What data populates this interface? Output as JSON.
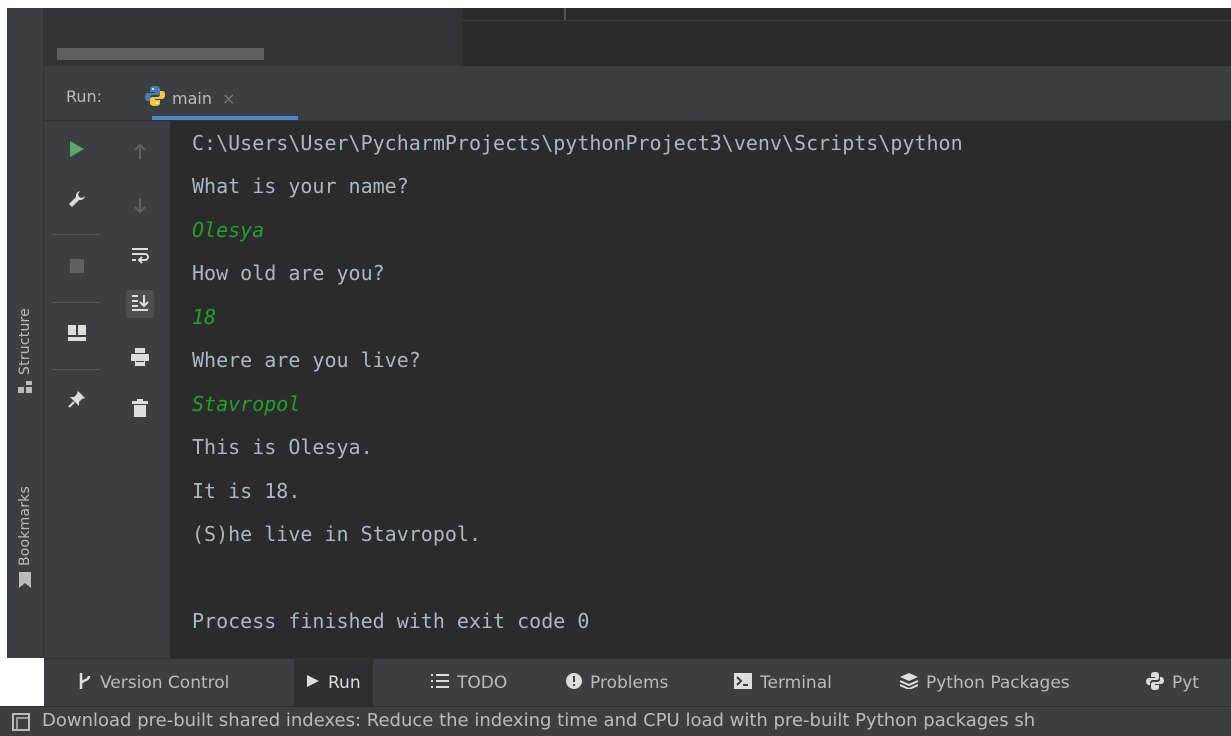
{
  "run_window": {
    "label": "Run:",
    "tab_label": "main",
    "tab_close": "×"
  },
  "left_strip": {
    "structure_label": "Structure",
    "bookmarks_label": "Bookmarks"
  },
  "toolbar_primary": [
    {
      "icon": "run-icon",
      "color": "#59a869"
    },
    {
      "icon": "wrench-icon"
    },
    {
      "icon": "stop-icon",
      "disabled": true
    },
    {
      "icon": "layout-icon"
    },
    {
      "icon": "pin-icon"
    }
  ],
  "toolbar_secondary": [
    {
      "icon": "arrow-up-icon",
      "disabled": true
    },
    {
      "icon": "arrow-down-icon",
      "disabled": true
    },
    {
      "icon": "soft-wrap-icon"
    },
    {
      "icon": "scroll-to-end-icon",
      "active": true
    },
    {
      "icon": "print-icon"
    },
    {
      "icon": "trash-icon"
    }
  ],
  "console": {
    "lines": [
      {
        "text": "C:\\Users\\User\\PycharmProjects\\pythonProject3\\venv\\Scripts\\python",
        "type": "output"
      },
      {
        "text": "What is your name?",
        "type": "output"
      },
      {
        "text": "Olesya",
        "type": "input"
      },
      {
        "text": "How old are you?",
        "type": "output"
      },
      {
        "text": "18",
        "type": "input"
      },
      {
        "text": "Where are you live?",
        "type": "output"
      },
      {
        "text": "Stavropol",
        "type": "input"
      },
      {
        "text": "This is Olesya.",
        "type": "output"
      },
      {
        "text": "It is 18.",
        "type": "output"
      },
      {
        "text": "(S)he live in Stavropol.",
        "type": "output"
      },
      {
        "text": "",
        "type": "output"
      },
      {
        "text": "Process finished with exit code 0",
        "type": "output"
      }
    ]
  },
  "bottom_tabs": [
    {
      "label": "Version Control",
      "icon": "branch-icon"
    },
    {
      "label": "Run",
      "icon": "play-icon",
      "active": true
    },
    {
      "label": "TODO",
      "icon": "list-icon"
    },
    {
      "label": "Problems",
      "icon": "warning-icon"
    },
    {
      "label": "Terminal",
      "icon": "terminal-icon"
    },
    {
      "label": "Python Packages",
      "icon": "layers-icon"
    },
    {
      "label": "Pyt",
      "icon": "python-icon"
    }
  ],
  "status_bar": {
    "message": "Download pre-built shared indexes: Reduce the indexing time and CPU load with pre-built Python packages sh"
  },
  "colors": {
    "output_text": "#a9b7c6",
    "input_text": "#1ea32a",
    "console_bg": "#2b2b2b",
    "panel_bg": "#3c3f41",
    "accent": "#4a88c7"
  }
}
